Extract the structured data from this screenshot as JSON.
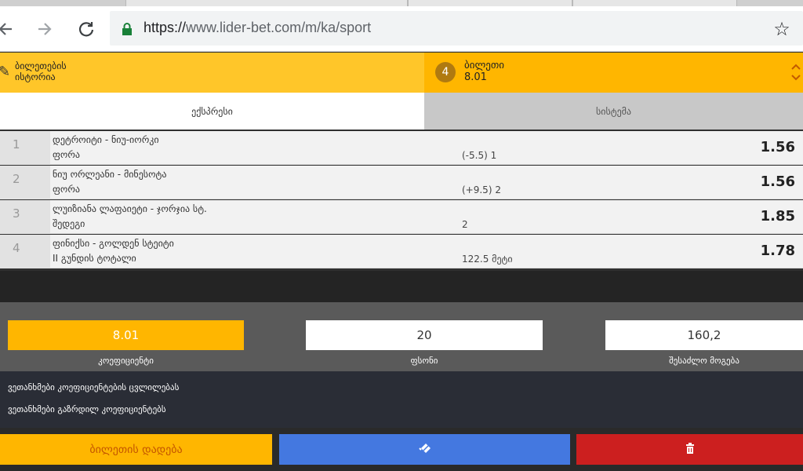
{
  "browser": {
    "url_host": "https://",
    "url_rest": "www.lider-bet.com/m/ka/sport",
    "back_icon": "arrow-left-icon",
    "forward_icon": "arrow-right-icon",
    "reload_icon": "reload-icon",
    "lock_icon": "lock-icon",
    "star_icon": "star-icon"
  },
  "header": {
    "history_label": "ბილეთების ისტორია",
    "ticket_count": "4",
    "ticket_title": "ბილეთი",
    "ticket_odds": "8.01"
  },
  "tabs": {
    "express": "ექსპრესი",
    "system": "სისტემა"
  },
  "bets": [
    {
      "num": "1",
      "event": "დეტროიტი - ნიუ-იორკი",
      "market": "ფორა",
      "pick": "(-5.5) 1",
      "odd": "1.56"
    },
    {
      "num": "2",
      "event": "ნიუ ორლეანი - მინესოტა",
      "market": "ფორა",
      "pick": "(+9.5) 2",
      "odd": "1.56"
    },
    {
      "num": "3",
      "event": "ლუიზიანა ლაფაიეტი - ჯორჯია სტ.",
      "market": "შედეგი",
      "pick": "2",
      "odd": "1.85"
    },
    {
      "num": "4",
      "event": "ფინიქსი - გოლდენ სტეიტი",
      "market": "II გუნდის ტოტალი",
      "pick": "122.5 მეტი",
      "odd": "1.78"
    }
  ],
  "stake": {
    "coef_value": "8.01",
    "coef_label": "კოეფიციენტი",
    "stake_value": "20",
    "stake_label": "ფსონი",
    "win_value": "160,2",
    "win_label": "შესაძლო მოგება"
  },
  "options": {
    "accept_changes": "ვეთანხმები კოეფიციენტების ცვლილებას",
    "accept_increase": "ვეთანხმები გაზრდილ კოეფიციენტებს"
  },
  "actions": {
    "place_label": "ბილეთის დადება"
  },
  "colors": {
    "accent": "#ffb600",
    "blue": "#4478e0",
    "red": "#cc1f1f"
  }
}
